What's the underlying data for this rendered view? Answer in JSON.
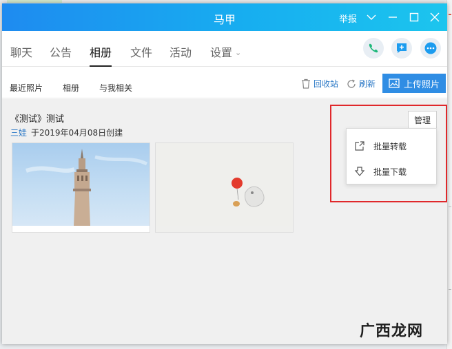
{
  "window": {
    "title": "马甲",
    "report_label": "举报"
  },
  "tabs": [
    {
      "label": "聊天"
    },
    {
      "label": "公告"
    },
    {
      "label": "相册"
    },
    {
      "label": "文件"
    },
    {
      "label": "活动"
    },
    {
      "label": "设置"
    }
  ],
  "subnav": {
    "links": [
      "最近照片",
      "相册",
      "与我相关"
    ],
    "recycle_label": "回收站",
    "refresh_label": "刷新",
    "upload_label": "上传照片"
  },
  "album": {
    "title": "《测试》测试",
    "author": "三娃",
    "created_text": "于2019年04月08日创建"
  },
  "manage": {
    "button_label": "管理",
    "menu": [
      "批量转载",
      "批量下载"
    ]
  },
  "watermark": {
    "text": "广西龙网"
  },
  "colors": {
    "accent": "#2f8de4",
    "highlight": "#e0282b",
    "link": "#2a78c6"
  },
  "icons": [
    "chevron-down-icon",
    "minimize-icon",
    "maximize-icon",
    "close-icon",
    "phone-icon",
    "chat-plus-icon",
    "more-icon",
    "trash-icon",
    "refresh-icon",
    "image-upload-icon",
    "share-icon",
    "download-icon"
  ]
}
